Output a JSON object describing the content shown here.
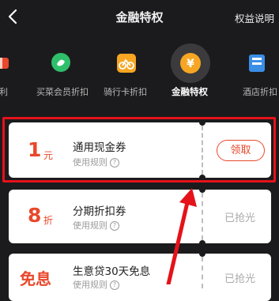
{
  "header": {
    "back_icon": "chevron-left-icon",
    "title": "金融特权",
    "explain_label": "权益说明"
  },
  "benefits": [
    {
      "label": "福利",
      "icon": "gift-icon",
      "color": "#e8482b"
    },
    {
      "label": "买菜会员折扣",
      "icon": "vegetable-icon",
      "color": "#2fbf6b"
    },
    {
      "label": "骑行卡折扣",
      "icon": "bicycle-icon",
      "color": "#f6a623"
    },
    {
      "label": "金融特权",
      "icon": "yen-coin-icon",
      "color": "#f6a623",
      "active": true
    },
    {
      "label": "酒店折扣",
      "icon": "hotel-icon",
      "color": "#3a8ee6"
    }
  ],
  "coupons": [
    {
      "amount": "1",
      "unit": "元",
      "name": "通用现金券",
      "rule": "使用规则",
      "action": "领取",
      "claimable": true
    },
    {
      "amount": "8",
      "unit": "折",
      "name": "分期折扣券",
      "rule": "使用规则",
      "action": "已抢光",
      "claimable": false
    },
    {
      "amount": "免息",
      "unit": "",
      "name": "生意贷30天免息",
      "rule": "使用规则",
      "action": "已抢光",
      "claimable": false
    }
  ],
  "colors": {
    "background": "#1b1b1d",
    "accent": "#e8482b",
    "highlight": "#e5121a"
  }
}
